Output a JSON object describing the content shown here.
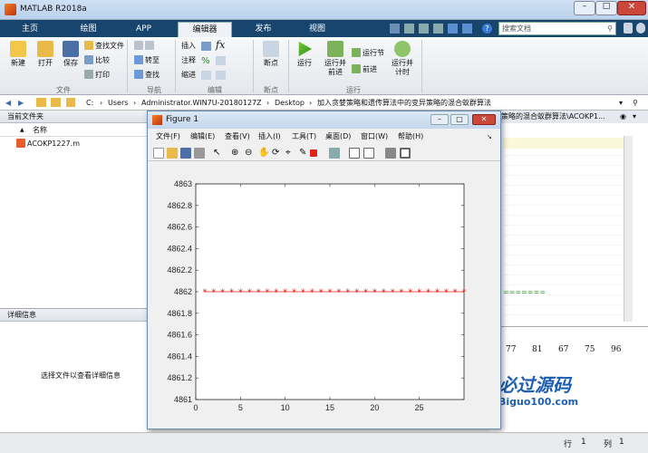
{
  "app": {
    "title": "MATLAB R2018a",
    "search_placeholder": "搜索文档"
  },
  "ribbon_tabs": [
    {
      "label": "主页"
    },
    {
      "label": "绘图"
    },
    {
      "label": "APP"
    },
    {
      "label": "编辑器"
    },
    {
      "label": "发布"
    },
    {
      "label": "视图"
    }
  ],
  "ribbon": {
    "new": "新建",
    "open": "打开",
    "save": "保存",
    "find_files": "查找文件",
    "compare": "比较",
    "print": "打印",
    "group_file": "文件",
    "goto": "转至",
    "find": "查找",
    "group_nav": "导航",
    "insert": "插入",
    "comment": "注释",
    "indent": "缩进",
    "group_edit": "编辑",
    "breakpoints": "断点",
    "group_bp": "断点",
    "run": "运行",
    "run_advance": "运行并\n前进",
    "run_section": "运行节",
    "advance": "前进",
    "run_time": "运行并\n计时",
    "group_run": "运行"
  },
  "address": {
    "path": [
      "C:",
      "Users",
      "Administrator.WIN7U-20180127Z",
      "Desktop",
      "加入贪婪策略和遗传算法中的变异策略的混合蚁群算法"
    ]
  },
  "current_folder": {
    "title": "当前文件夹",
    "col_name": "名称",
    "col_sort": "▲",
    "files": [
      "ACOKP1227.m"
    ]
  },
  "details": {
    "title": "详细信息",
    "message": "选择文件以查看详细信息"
  },
  "editor": {
    "tab_path": "策略的混合蚁群算法\\ACOKP1...",
    "dashes": "======="
  },
  "workspace_numbers": [
    "77",
    "81",
    "67",
    "75",
    "96"
  ],
  "figure": {
    "title": "Figure 1",
    "menus": [
      "文件(F)",
      "编辑(E)",
      "查看(V)",
      "插入(I)",
      "工具(T)",
      "桌面(D)",
      "窗口(W)",
      "帮助(H)"
    ]
  },
  "chart_data": {
    "type": "line",
    "x": [
      1,
      2,
      3,
      4,
      5,
      6,
      7,
      8,
      9,
      10,
      11,
      12,
      13,
      14,
      15,
      16,
      17,
      18,
      19,
      20,
      21,
      22,
      23,
      24,
      25,
      26,
      27,
      28,
      29,
      30
    ],
    "series": [
      {
        "values": [
          4862,
          4862,
          4862,
          4862,
          4862,
          4862,
          4862,
          4862,
          4862,
          4862,
          4862,
          4862,
          4862,
          4862,
          4862,
          4862,
          4862,
          4862,
          4862,
          4862,
          4862,
          4862,
          4862,
          4862,
          4862,
          4862,
          4862,
          4862,
          4862,
          4862
        ],
        "color": "#e2231a",
        "marker": "*"
      }
    ],
    "xlim": [
      0,
      30
    ],
    "ylim": [
      4861,
      4863
    ],
    "xticks": [
      0,
      5,
      10,
      15,
      20,
      25
    ],
    "yticks": [
      "4861",
      "4861.2",
      "4861.4",
      "4861.6",
      "4861.8",
      "4862",
      "4862.2",
      "4862.4",
      "4862.6",
      "4862.8",
      "4863"
    ],
    "grid": false
  },
  "watermark": {
    "text": "必过源码",
    "url": "Biguo100.com"
  },
  "status": {
    "row_label": "行",
    "row": "1",
    "col_label": "列",
    "col": "1"
  }
}
